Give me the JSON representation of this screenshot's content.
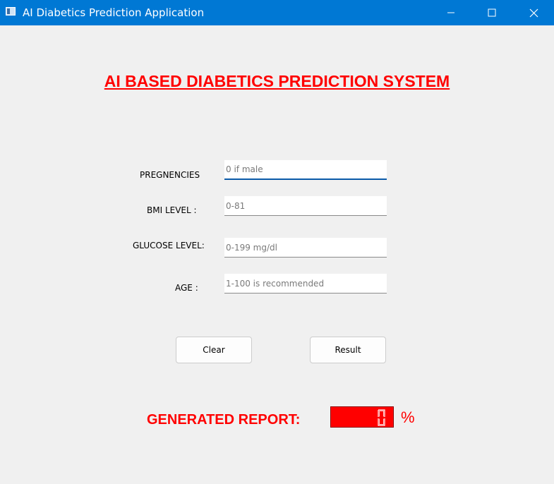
{
  "window": {
    "title": "AI Diabetics Prediction Application"
  },
  "main": {
    "heading": "AI BASED DIABETICS PREDICTION SYSTEM"
  },
  "form": {
    "pregnancies": {
      "label": "PREGNENCIES",
      "value": "",
      "placeholder": "0 if male"
    },
    "bmi": {
      "label": "BMI LEVEL :",
      "value": "",
      "placeholder": "0-81"
    },
    "glucose": {
      "label": "GLUCOSE LEVEL:",
      "value": "",
      "placeholder": "0-199 mg/dl"
    },
    "age": {
      "label": "AGE :",
      "value": "",
      "placeholder": "1-100 is recommended"
    }
  },
  "buttons": {
    "clear": "Clear",
    "result": "Result"
  },
  "report": {
    "label": "GENERATED REPORT:",
    "lcd_value": "0",
    "unit": "%"
  },
  "colors": {
    "titlebar": "#0078d4",
    "accent_red": "#ff0000"
  }
}
